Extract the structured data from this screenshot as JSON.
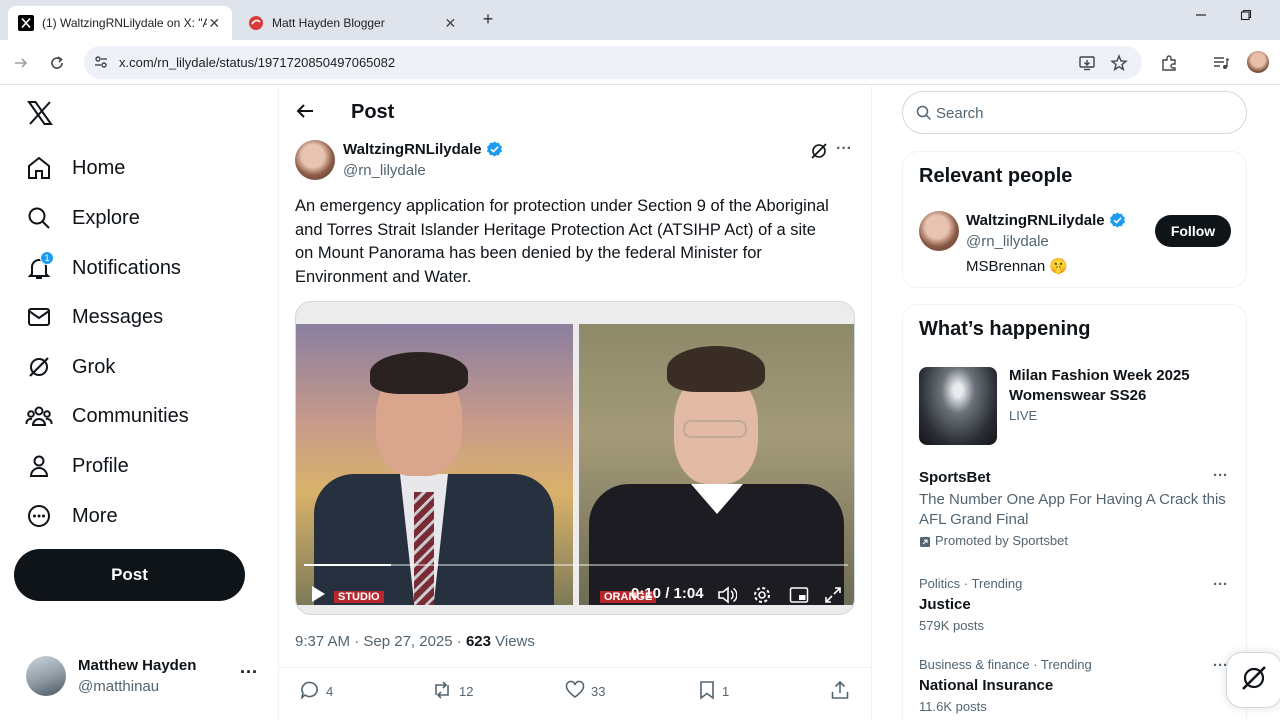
{
  "browser": {
    "tabs": [
      {
        "title": "(1) WaltzingRNLilydale on X: \"A",
        "close": "✕"
      },
      {
        "title": "Matt Hayden Blogger",
        "close": "✕"
      }
    ],
    "new_tab": "+",
    "url": "x.com/rn_lilydale/status/1971720850497065082"
  },
  "nav": {
    "items": [
      {
        "label": "Home"
      },
      {
        "label": "Explore"
      },
      {
        "label": "Notifications",
        "badge": "1"
      },
      {
        "label": "Messages"
      },
      {
        "label": "Grok"
      },
      {
        "label": "Communities"
      },
      {
        "label": "Profile"
      },
      {
        "label": "More"
      }
    ],
    "post_button": "Post",
    "account": {
      "name": "Matthew Hayden",
      "handle": "@matthinau",
      "more": "···"
    }
  },
  "main": {
    "title": "Post",
    "tweet": {
      "author_name": "WaltzingRNLilydale",
      "author_handle": "@rn_lilydale",
      "text": "An emergency application for protection under Section 9 of the Aboriginal and Torres Strait Islander Heritage Protection Act (ATSIHP Act) of a site on Mount Panorama has been denied by the federal Minister for Environment and Water.",
      "video": {
        "time": "0:10 / 1:04",
        "progress": 0.16,
        "left_tag": "STUDIO",
        "right_tag": "ORANGE"
      },
      "timestamp": "9:37 AM · Sep 27, 2025 · ",
      "views_count": "623",
      "views_label": " Views",
      "replies": "4",
      "reposts": "12",
      "likes": "33",
      "bookmarks": "1"
    }
  },
  "sidebar": {
    "search_placeholder": "Search",
    "relevant": {
      "title": "Relevant people",
      "name": "WaltzingRNLilydale",
      "handle": "@rn_lilydale",
      "bio": "MSBrennan 🤫",
      "follow": "Follow"
    },
    "happening": {
      "title": "What’s happening",
      "feature": {
        "title_line1": "Milan Fashion Week 2025",
        "title_line2": "Womenswear SS26",
        "status": "LIVE"
      },
      "promo": {
        "name": "SportsBet",
        "line1": "The Number One App For Having A Crack this",
        "line2": "AFL Grand Final",
        "promoted": "Promoted by Sportsbet"
      },
      "trends": [
        {
          "context": "Politics · Trending",
          "name": "Justice",
          "posts": "579K posts"
        },
        {
          "context": "Business & finance · Trending",
          "name": "National Insurance",
          "posts": "11.6K posts"
        }
      ],
      "dots": "···"
    }
  }
}
